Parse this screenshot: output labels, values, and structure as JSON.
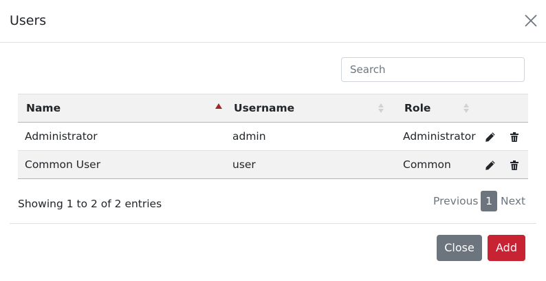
{
  "modal": {
    "title": "Users",
    "close_icon": "close-x-icon"
  },
  "search": {
    "placeholder": "Search",
    "value": ""
  },
  "table": {
    "columns": [
      {
        "label": "Name",
        "sort": "ascending"
      },
      {
        "label": "Username",
        "sort": "none"
      },
      {
        "label": "Role",
        "sort": "none"
      },
      {
        "label": "",
        "sort": "disabled"
      }
    ],
    "rows": [
      {
        "name": "Administrator",
        "username": "admin",
        "role": "Administrator",
        "actions": [
          "pencil-icon",
          "trash-icon"
        ]
      },
      {
        "name": "Common User",
        "username": "user",
        "role": "Common",
        "actions": [
          "pencil-icon",
          "trash-icon"
        ]
      }
    ]
  },
  "info": "Showing 1 to 2 of 2 entries",
  "pagination": {
    "previous": "Previous",
    "current": "1",
    "next": "Next"
  },
  "footer": {
    "close_label": "Close",
    "add_label": "Add"
  },
  "colors": {
    "sort_active": "#a0262d",
    "sort_inactive": "#cdd2d6",
    "close_button": "#6c757d",
    "add_button": "#c82333",
    "current_page": "#6c757d"
  }
}
